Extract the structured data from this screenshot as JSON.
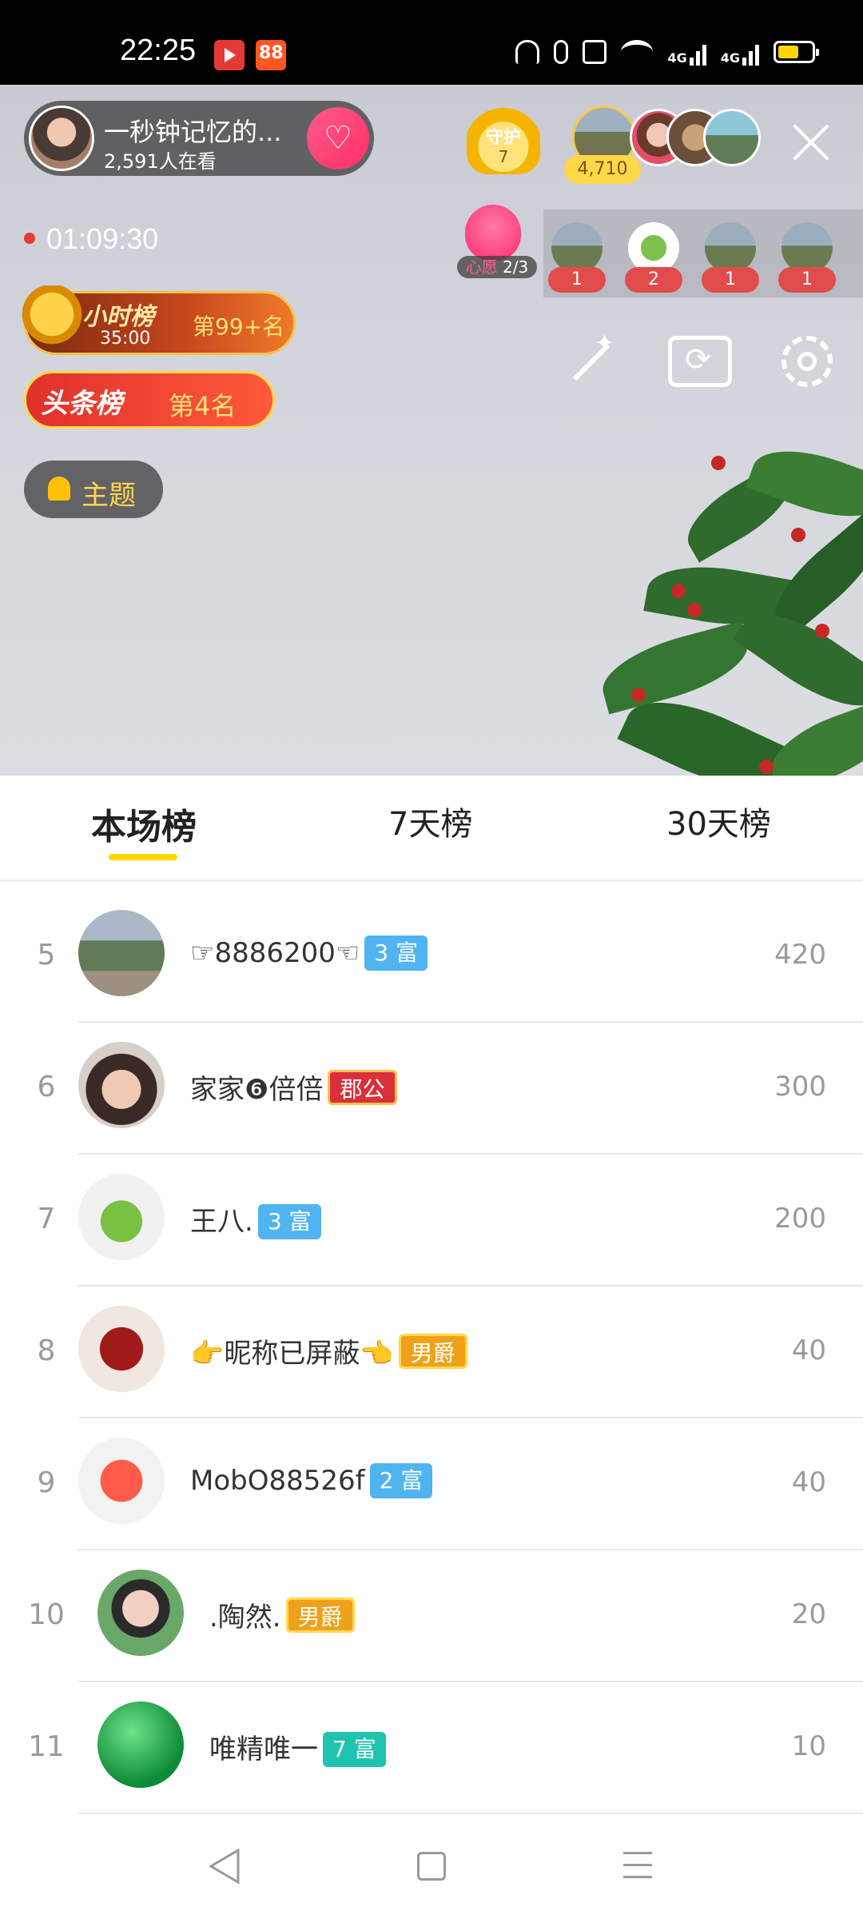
{
  "status_bar": {
    "time": "22:25",
    "signal_1": "4G",
    "signal_2": "4G"
  },
  "stream": {
    "host_name": "一秒钟记忆的...",
    "viewers": "2,591人在看",
    "timer": "01:09:30",
    "guard_label": "守护",
    "guard_count": "7",
    "viewer_total": "4,710",
    "wish_label": "心愿",
    "wish_progress": "2/3",
    "gift_counts": [
      "1",
      "2",
      "1",
      "1"
    ],
    "hour_rank_title": "小时榜",
    "hour_rank_time": "35:00",
    "hour_rank_pos": "第99+名",
    "headline_rank_title": "头条榜",
    "headline_rank_pos": "第4名",
    "theme_label": "主题"
  },
  "tabs": [
    "本场榜",
    "7天榜",
    "30天榜"
  ],
  "leaderboard": [
    {
      "rank": "5",
      "name": "☞8886200☜",
      "badge": "3 富",
      "score": "420"
    },
    {
      "rank": "6",
      "name": "家家❻倍倍",
      "badge": "郡公",
      "score": "300"
    },
    {
      "rank": "7",
      "name": "王八.",
      "badge": "3 富",
      "score": "200"
    },
    {
      "rank": "8",
      "name": "👉昵称已屏蔽👈",
      "badge": "男爵",
      "score": "40"
    },
    {
      "rank": "9",
      "name": "MobO88526f",
      "badge": "2 富",
      "score": "40"
    },
    {
      "rank": "10",
      "name": ".陶然.",
      "badge": "男爵",
      "score": "20"
    },
    {
      "rank": "11",
      "name": "唯精唯一",
      "badge": "7 富",
      "score": "10"
    }
  ],
  "colors": {
    "accent": "#ffd600",
    "badge_blue": "#4fb4ef",
    "badge_teal": "#1fc3b0",
    "badge_red": "#d9303c",
    "badge_gold": "#f0a11a"
  }
}
